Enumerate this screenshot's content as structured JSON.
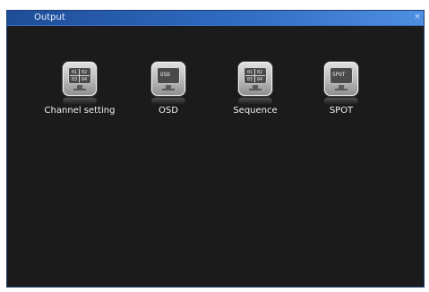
{
  "window": {
    "title": "Output",
    "close_glyph": "×"
  },
  "menu": {
    "items": [
      {
        "label": "Channel setting",
        "icon": "channel-grid-icon",
        "screen_text": [
          "01",
          "02",
          "03",
          "04"
        ]
      },
      {
        "label": "OSD",
        "icon": "osd-monitor-icon",
        "screen_text": "OSD"
      },
      {
        "label": "Sequence",
        "icon": "sequence-grid-icon",
        "screen_text": [
          "01",
          "02",
          "03",
          "04"
        ]
      },
      {
        "label": "SPOT",
        "icon": "spot-monitor-icon",
        "screen_text": "SPOT"
      }
    ]
  }
}
